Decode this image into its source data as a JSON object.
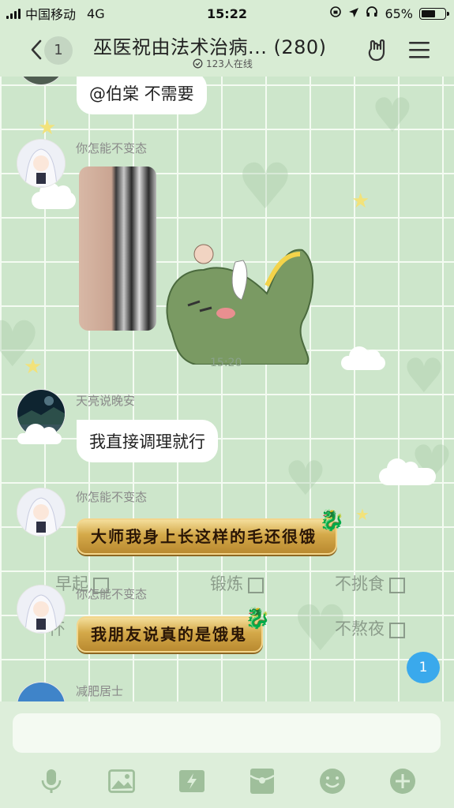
{
  "status_bar": {
    "carrier": "中国移动",
    "network": "4G",
    "time": "15:22",
    "battery": "65%",
    "battery_level": 0.65
  },
  "nav": {
    "back_count": "1",
    "title": "巫医祝由法术治病... (280)",
    "online": "123人在线"
  },
  "messages": [
    {
      "type": "text",
      "text": "@伯棠 不需要"
    },
    {
      "type": "image",
      "sender": "你怎能不变态"
    },
    {
      "type": "time",
      "text": "15:20"
    },
    {
      "type": "text",
      "sender": "天亮说晚安",
      "text": "我直接调理就行"
    },
    {
      "type": "gold",
      "sender": "你怎能不变态",
      "text": "大师我身上长这样的毛还很饿"
    },
    {
      "type": "gold",
      "sender": "你怎能不变态",
      "text": "我朋友说真的是饿鬼"
    },
    {
      "type": "partial",
      "sender": "减肥居士"
    }
  ],
  "overlay": {
    "items": [
      "早起",
      "锻炼",
      "不挑食",
      "一杯",
      "不熬夜"
    ]
  },
  "unread": "1",
  "colors": {
    "accent": "#3aa9ec",
    "bubble": "#ffffff",
    "gold": "#d4a949",
    "background": "#cde6cb"
  },
  "toolbar": {
    "icons": [
      "mic-icon",
      "image-icon",
      "flash-icon",
      "redpacket-icon",
      "emoji-icon",
      "plus-icon"
    ]
  }
}
